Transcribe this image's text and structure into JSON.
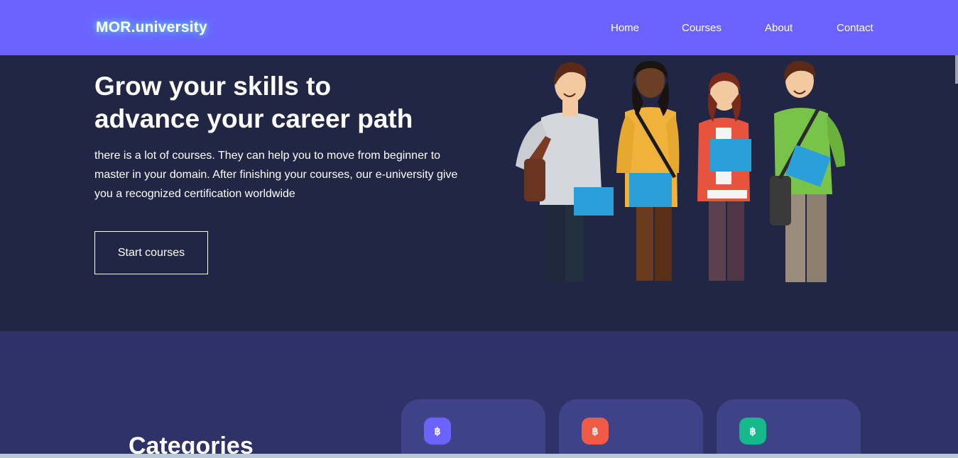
{
  "nav": {
    "logo": "MOR.university",
    "links": [
      "Home",
      "Courses",
      "About",
      "Contact"
    ]
  },
  "hero": {
    "title_line1": "Grow your skills to",
    "title_line2": "advance your career path",
    "description": "there is a lot of courses. They can help you to move from beginner to master in your domain. After finishing your courses, our e-university give you a recognized certification worldwide",
    "button_label": "Start courses"
  },
  "categories": {
    "title": "Categories",
    "cards": [
      {
        "icon_symbol": "฿",
        "icon_name": "bitcoin-icon",
        "icon_color": "#6c63ff"
      },
      {
        "icon_symbol": "฿",
        "icon_name": "bitcoin-icon",
        "icon_color": "#f05a46"
      },
      {
        "icon_symbol": "฿",
        "icon_name": "bitcoin-icon",
        "icon_color": "#15b98c"
      }
    ]
  },
  "colors": {
    "brand": "#6c63ff",
    "hero_bg": "#212644",
    "section_bg": "#2e3267",
    "card_bg": "#3e4287"
  }
}
